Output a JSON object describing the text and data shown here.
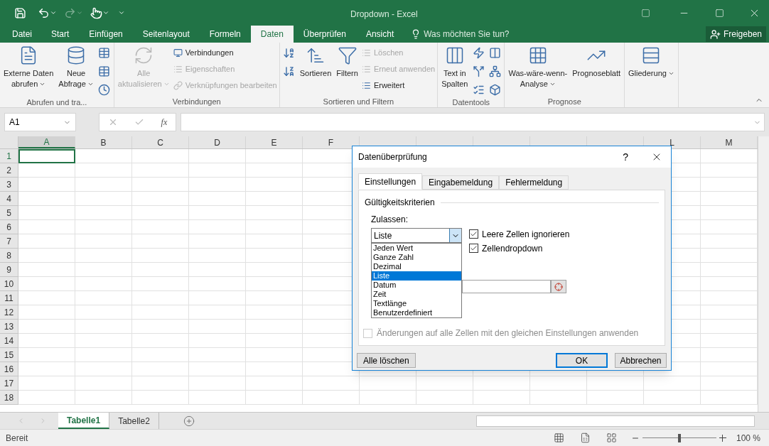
{
  "window": {
    "title": "Dropdown - Excel"
  },
  "menu_tabs": [
    {
      "label": "Datei",
      "selected": false
    },
    {
      "label": "Start",
      "selected": false
    },
    {
      "label": "Einfügen",
      "selected": false
    },
    {
      "label": "Seitenlayout",
      "selected": false
    },
    {
      "label": "Formeln",
      "selected": false
    },
    {
      "label": "Daten",
      "selected": true
    },
    {
      "label": "Überprüfen",
      "selected": false
    },
    {
      "label": "Ansicht",
      "selected": false
    }
  ],
  "tell_me": {
    "placeholder": "Was möchten Sie tun?"
  },
  "share_button": "Freigeben",
  "ribbon_groups": [
    {
      "label": "Abrufen und tra...",
      "items": [
        {
          "kind": "large",
          "lines": [
            "Externe Daten",
            "abrufen"
          ],
          "dropdown": true,
          "disabled": false
        },
        {
          "kind": "large",
          "lines": [
            "Neue",
            "Abfrage"
          ],
          "dropdown": true,
          "disabled": false
        },
        {
          "kind": "icons"
        }
      ]
    },
    {
      "label": "Verbindungen",
      "items": [
        {
          "kind": "large",
          "lines": [
            "Alle",
            "aktualisieren"
          ],
          "dropdown": true,
          "disabled": true
        },
        {
          "kind": "stack",
          "buttons": [
            {
              "label": "Verbindungen",
              "disabled": false
            },
            {
              "label": "Eigenschaften",
              "disabled": true
            },
            {
              "label": "Verknüpfungen bearbeiten",
              "disabled": true
            }
          ]
        }
      ]
    },
    {
      "label": "Sortieren und Filtern",
      "items": [
        {
          "kind": "icons"
        },
        {
          "kind": "large",
          "lines": [
            "Sortieren"
          ],
          "dropdown": false,
          "disabled": false
        },
        {
          "kind": "large",
          "lines": [
            "Filtern"
          ],
          "dropdown": false,
          "disabled": false
        },
        {
          "kind": "stack",
          "buttons": [
            {
              "label": "Löschen",
              "disabled": true
            },
            {
              "label": "Erneut anwenden",
              "disabled": true
            },
            {
              "label": "Erweitert",
              "disabled": false
            }
          ]
        }
      ]
    },
    {
      "label": "Datentools",
      "items": [
        {
          "kind": "large",
          "lines": [
            "Text in",
            "Spalten"
          ],
          "dropdown": false,
          "disabled": false
        },
        {
          "kind": "icons"
        },
        {
          "kind": "icons"
        }
      ]
    },
    {
      "label": "Prognose",
      "items": [
        {
          "kind": "large",
          "lines": [
            "Was-wäre-wenn-",
            "Analyse"
          ],
          "dropdown": true,
          "disabled": false
        },
        {
          "kind": "large",
          "lines": [
            "Prognoseblatt"
          ],
          "dropdown": false,
          "disabled": false
        }
      ]
    },
    {
      "items": [
        {
          "kind": "large",
          "lines": [
            "Gliederung"
          ],
          "dropdown": true,
          "disabled": false
        }
      ]
    }
  ],
  "name_box": "A1",
  "function_label": "fx",
  "columns": [
    {
      "label": "A",
      "selected": true
    },
    {
      "label": "B",
      "selected": false
    },
    {
      "label": "C",
      "selected": false
    },
    {
      "label": "D",
      "selected": false
    },
    {
      "label": "E",
      "selected": false
    },
    {
      "label": "F",
      "selected": false
    },
    {
      "selected": false
    },
    {
      "selected": false
    },
    {
      "selected": false
    },
    {
      "selected": false
    },
    {
      "selected": false
    },
    {
      "label": "L",
      "selected": false
    },
    {
      "label": "M",
      "selected": false
    }
  ],
  "rows": [
    {
      "label": "1",
      "selected": true
    },
    {
      "label": "2",
      "selected": false
    },
    {
      "label": "3",
      "selected": false
    },
    {
      "label": "4",
      "selected": false
    },
    {
      "label": "5",
      "selected": false
    },
    {
      "label": "6",
      "selected": false
    },
    {
      "label": "7",
      "selected": false
    },
    {
      "label": "8",
      "selected": false
    },
    {
      "label": "9",
      "selected": false
    },
    {
      "label": "10",
      "selected": false
    },
    {
      "label": "11",
      "selected": false
    },
    {
      "label": "12",
      "selected": false
    },
    {
      "label": "13",
      "selected": false
    },
    {
      "label": "14",
      "selected": false
    },
    {
      "label": "15",
      "selected": false
    },
    {
      "label": "16",
      "selected": false
    },
    {
      "label": "17",
      "selected": false
    },
    {
      "label": "18",
      "selected": false
    }
  ],
  "sheet_tabs": [
    {
      "label": "Tabelle1",
      "selected": true
    },
    {
      "label": "Tabelle2",
      "selected": false
    }
  ],
  "status_bar": {
    "status": "Bereit",
    "zoom": "100 %",
    "zoom_slider": {
      "level": 0.5
    }
  },
  "dialog": {
    "title": "Datenüberprüfung",
    "help": "?",
    "tabs": [
      {
        "label": "Einstellungen",
        "selected": true
      },
      {
        "label": "Eingabemeldung",
        "selected": false
      },
      {
        "label": "Fehlermeldung",
        "selected": false
      }
    ],
    "section": "Gültigkeitskriterien",
    "allow_label": "Zulassen:",
    "allow_select": {
      "value": "Liste",
      "expanded": true,
      "options": [
        {
          "label": "Jeden Wert",
          "selected": false
        },
        {
          "label": "Ganze Zahl",
          "selected": false
        },
        {
          "label": "Dezimal",
          "selected": false
        },
        {
          "label": "Liste",
          "selected": true
        },
        {
          "label": "Datum",
          "selected": false
        },
        {
          "label": "Zeit",
          "selected": false
        },
        {
          "label": "Textlänge",
          "selected": false
        },
        {
          "label": "Benutzerdefiniert",
          "selected": false
        }
      ]
    },
    "checkboxes": [
      {
        "label": "Leere Zellen ignorieren",
        "checked": true
      },
      {
        "label": "Zellendropdown",
        "checked": true
      }
    ],
    "apply_all": {
      "label": "Änderungen auf alle Zellen mit den gleichen Einstellungen anwenden",
      "checked": false,
      "disabled": true
    },
    "buttons": [
      {
        "label": "Alle löschen",
        "default": false
      },
      {
        "label": "OK",
        "default": true
      },
      {
        "label": "Abbrechen",
        "default": false
      }
    ]
  }
}
